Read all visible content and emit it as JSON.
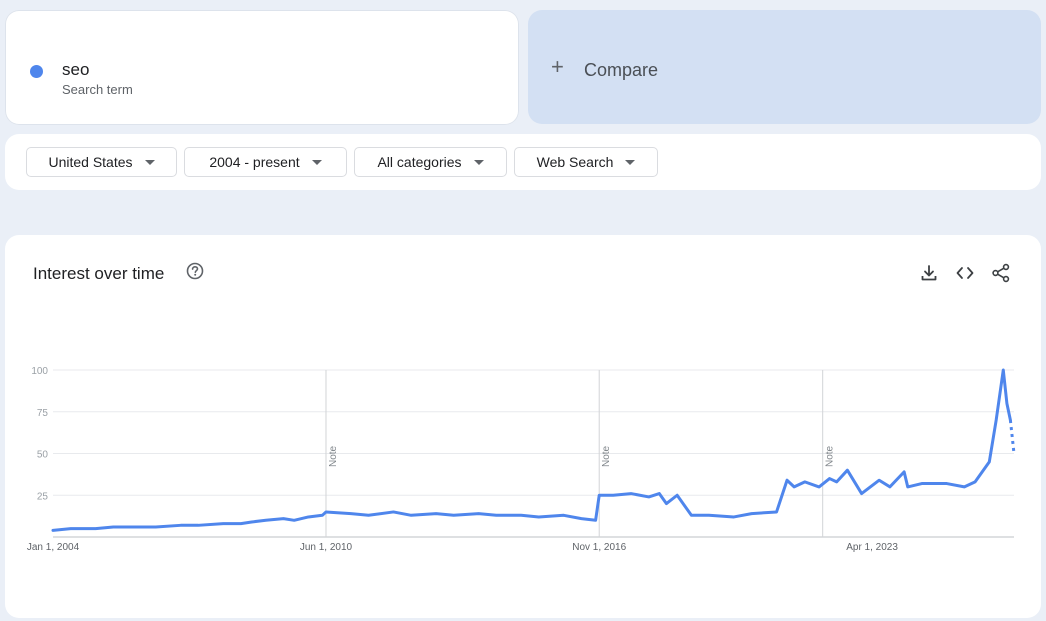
{
  "term": {
    "name": "seo",
    "subtitle": "Search term",
    "color": "#4f86ec"
  },
  "compare": {
    "label": "Compare",
    "plus": "+"
  },
  "filters": [
    {
      "label": "United States"
    },
    {
      "label": "2004 - present"
    },
    {
      "label": "All categories"
    },
    {
      "label": "Web Search"
    }
  ],
  "chart": {
    "title": "Interest over time",
    "icons": [
      "help-icon",
      "download-icon",
      "embed-icon",
      "share-icon"
    ],
    "note_label": "Note"
  },
  "chart_data": {
    "type": "line",
    "title": "Interest over time",
    "xlabel": "",
    "ylabel": "",
    "ylim": [
      0,
      100
    ],
    "yticks": [
      25,
      50,
      75,
      100
    ],
    "xticks": [
      "Jan 1, 2004",
      "Jun 1, 2010",
      "Nov 1, 2016",
      "Apr 1, 2023"
    ],
    "notes": [
      "Jun 1, 2010",
      "Nov 1, 2016",
      "Feb 1, 2022"
    ],
    "grid": true,
    "color": "#4f86ec",
    "series": [
      {
        "name": "seo",
        "points": [
          [
            "2004-01-01",
            4
          ],
          [
            "2004-06-01",
            5
          ],
          [
            "2005-01-01",
            5
          ],
          [
            "2005-06-01",
            6
          ],
          [
            "2006-01-01",
            6
          ],
          [
            "2006-06-01",
            6
          ],
          [
            "2007-01-01",
            7
          ],
          [
            "2007-06-01",
            7
          ],
          [
            "2008-01-01",
            8
          ],
          [
            "2008-06-01",
            8
          ],
          [
            "2008-09-01",
            9
          ],
          [
            "2009-01-01",
            10
          ],
          [
            "2009-06-01",
            11
          ],
          [
            "2009-09-01",
            10
          ],
          [
            "2010-01-01",
            12
          ],
          [
            "2010-05-01",
            13
          ],
          [
            "2010-06-01",
            15
          ],
          [
            "2011-01-01",
            14
          ],
          [
            "2011-06-01",
            13
          ],
          [
            "2012-01-01",
            15
          ],
          [
            "2012-06-01",
            13
          ],
          [
            "2013-01-01",
            14
          ],
          [
            "2013-06-01",
            13
          ],
          [
            "2014-01-01",
            14
          ],
          [
            "2014-06-01",
            13
          ],
          [
            "2015-01-01",
            13
          ],
          [
            "2015-06-01",
            12
          ],
          [
            "2016-01-01",
            13
          ],
          [
            "2016-06-01",
            11
          ],
          [
            "2016-10-01",
            10
          ],
          [
            "2016-11-01",
            25
          ],
          [
            "2017-03-01",
            25
          ],
          [
            "2017-08-01",
            26
          ],
          [
            "2018-01-01",
            24
          ],
          [
            "2018-04-01",
            26
          ],
          [
            "2018-06-01",
            20
          ],
          [
            "2018-09-01",
            25
          ],
          [
            "2019-01-01",
            13
          ],
          [
            "2019-06-01",
            13
          ],
          [
            "2020-01-01",
            12
          ],
          [
            "2020-06-01",
            14
          ],
          [
            "2021-01-01",
            15
          ],
          [
            "2021-04-01",
            34
          ],
          [
            "2021-06-01",
            30
          ],
          [
            "2021-09-01",
            33
          ],
          [
            "2022-01-01",
            30
          ],
          [
            "2022-04-01",
            35
          ],
          [
            "2022-06-01",
            33
          ],
          [
            "2022-09-01",
            40
          ],
          [
            "2023-01-01",
            26
          ],
          [
            "2023-06-01",
            34
          ],
          [
            "2023-09-01",
            30
          ],
          [
            "2024-01-01",
            39
          ],
          [
            "2024-02-01",
            30
          ],
          [
            "2024-06-01",
            32
          ],
          [
            "2025-01-01",
            32
          ],
          [
            "2025-06-01",
            30
          ],
          [
            "2025-09-01",
            33
          ],
          [
            "2026-01-01",
            45
          ],
          [
            "2026-03-01",
            70
          ],
          [
            "2026-05-01",
            100
          ],
          [
            "2026-06-01",
            80
          ],
          [
            "2026-07-01",
            70
          ]
        ],
        "partial_points": [
          [
            "2026-07-01",
            70
          ],
          [
            "2026-08-01",
            50
          ]
        ]
      }
    ]
  }
}
